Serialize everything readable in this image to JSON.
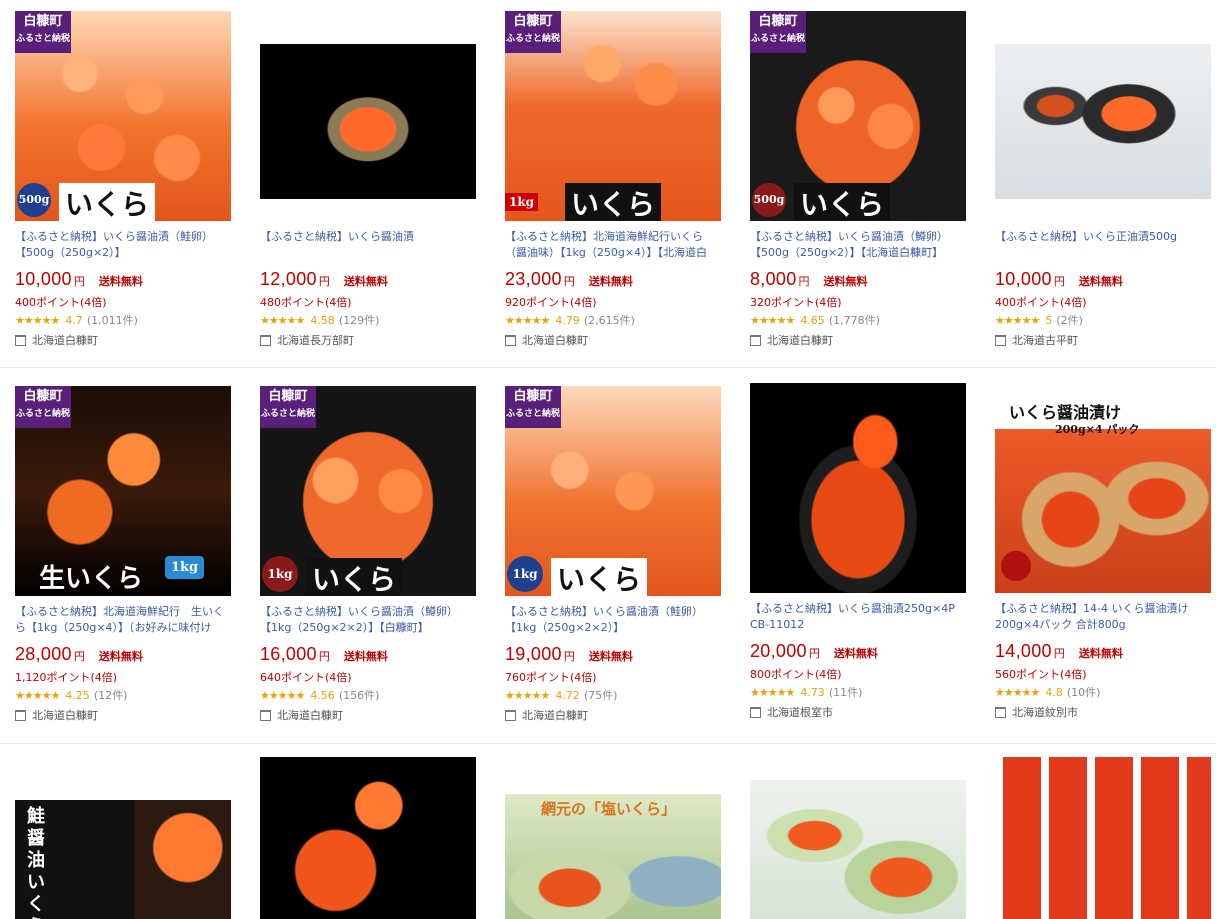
{
  "products": [
    {
      "title": "【ふるさと納税】いくら醤油漬（鮭卵）【500g（250g×2）】",
      "price": "10,000",
      "yen": "円",
      "shipping": "送料無料",
      "points": "400ポイント(4倍)",
      "stars": "★★★★★",
      "score": "4.7",
      "count": "(1,011件)",
      "shop": "北海道白糠町",
      "img": "ikura-bowl",
      "badge": "白糠町",
      "badge2": "ふるさと納税",
      "overlay": "いくら",
      "weight": "500g"
    },
    {
      "title": "【ふるさと納税】いくら醤油漬",
      "price": "12,000",
      "yen": "円",
      "shipping": "送料無料",
      "points": "480ポイント(4倍)",
      "stars": "★★★★★",
      "score": "4.58",
      "count": "(129件)",
      "shop": "北海道長万部町",
      "img": "dark-cup",
      "badge": "",
      "badge2": "",
      "overlay": "",
      "weight": ""
    },
    {
      "title": "【ふるさと納税】北海道海鮮紀行いくら（醤油味）【1kg（250g×4）】【北海道白糠…",
      "price": "23,000",
      "yen": "円",
      "shipping": "送料無料",
      "points": "920ポイント(4倍)",
      "stars": "★★★★★",
      "score": "4.79",
      "count": "(2,615件)",
      "shop": "北海道白糠町",
      "img": "spoon",
      "badge": "白糠町",
      "badge2": "ふるさと納税",
      "overlay": "いくら",
      "weight": "1kg"
    },
    {
      "title": "【ふるさと納税】いくら醤油漬（鱒卵）【500g（250g×2）】【北海道白糠町】",
      "price": "8,000",
      "yen": "円",
      "shipping": "送料無料",
      "points": "320ポイント(4倍)",
      "stars": "★★★★★",
      "score": "4.65",
      "count": "(1,778件)",
      "shop": "北海道白糠町",
      "img": "dark-bowl",
      "badge": "白糠町",
      "badge2": "ふるさと納税",
      "overlay": "いくら",
      "weight": "500g"
    },
    {
      "title": "【ふるさと納税】いくら正油漬500g",
      "price": "10,000",
      "yen": "円",
      "shipping": "送料無料",
      "points": "400ポイント(4倍)",
      "stars": "★★★★★",
      "score": "5",
      "count": "(2件)",
      "shop": "北海道古平町",
      "img": "light-bowls",
      "badge": "",
      "badge2": "",
      "overlay": "",
      "weight": ""
    },
    {
      "title": "【ふるさと納税】北海道海鮮紀行　生いくら【1kg（250g×4）】〔お好みに味付けが…",
      "price": "28,000",
      "yen": "円",
      "shipping": "送料無料",
      "points": "1,120ポイント(4倍)",
      "stars": "★★★★★",
      "score": "4.25",
      "count": "(12件)",
      "shop": "北海道白糠町",
      "img": "black-box",
      "badge": "白糠町",
      "badge2": "ふるさと納税",
      "overlay": "生いくら",
      "weight": "1kg"
    },
    {
      "title": "【ふるさと納税】いくら醤油漬（鱒卵）【1kg（250g×2×2）】【白糠町】",
      "price": "16,000",
      "yen": "円",
      "shipping": "送料無料",
      "points": "640ポイント(4倍)",
      "stars": "★★★★★",
      "score": "4.56",
      "count": "(156件)",
      "shop": "北海道白糠町",
      "img": "dark-bowl",
      "badge": "白糠町",
      "badge2": "ふるさと納税",
      "overlay": "いくら",
      "weight": "1kg"
    },
    {
      "title": "【ふるさと納税】いくら醤油漬（鮭卵）【1kg（250g×2×2）】",
      "price": "19,000",
      "yen": "円",
      "shipping": "送料無料",
      "points": "760ポイント(4倍)",
      "stars": "★★★★★",
      "score": "4.72",
      "count": "(75件)",
      "shop": "北海道白糠町",
      "img": "ikura-bowl",
      "badge": "白糠町",
      "badge2": "ふるさと納税",
      "overlay": "いくら",
      "weight": "1kg"
    },
    {
      "title": "【ふるさと納税】いくら醤油漬250g×4P CB-11012",
      "price": "20,000",
      "yen": "円",
      "shipping": "送料無料",
      "points": "800ポイント(4倍)",
      "stars": "★★★★★",
      "score": "4.73",
      "count": "(11件)",
      "shop": "北海道根室市",
      "img": "dark-cup",
      "badge": "",
      "badge2": "",
      "overlay": "",
      "weight": ""
    },
    {
      "title": "【ふるさと納税】14-4 いくら醤油漬け200g×4パック 合計800g",
      "price": "14,000",
      "yen": "円",
      "shipping": "送料無料",
      "points": "560ポイント(4倍)",
      "stars": "★★★★★",
      "score": "4.8",
      "count": "(10件)",
      "shop": "北海道紋別市",
      "img": "wood-box",
      "badge": "",
      "badge2": "",
      "overlay": "いくら醤油漬け",
      "weight": "200g×4 パック"
    },
    {
      "title": "",
      "price": "",
      "yen": "",
      "shipping": "",
      "points": "",
      "stars": "",
      "score": "",
      "count": "",
      "shop": "",
      "img": "black-label",
      "badge": "",
      "badge2": "",
      "overlay": "鮭醤油いくら",
      "weight": ""
    },
    {
      "title": "",
      "price": "",
      "yen": "",
      "shipping": "",
      "points": "",
      "stars": "",
      "score": "",
      "count": "",
      "shop": "",
      "img": "spoon-dark",
      "badge": "",
      "badge2": "",
      "overlay": "",
      "weight": ""
    },
    {
      "title": "",
      "price": "",
      "yen": "",
      "shipping": "",
      "points": "",
      "stars": "",
      "score": "",
      "count": "",
      "shop": "",
      "img": "green-bowls",
      "badge": "",
      "badge2": "",
      "overlay": "網元の「塩いくら」",
      "weight": ""
    },
    {
      "title": "",
      "price": "",
      "yen": "",
      "shipping": "",
      "points": "",
      "stars": "",
      "score": "",
      "count": "",
      "shop": "",
      "img": "light-bowls2",
      "badge": "",
      "badge2": "",
      "overlay": "",
      "weight": ""
    },
    {
      "title": "",
      "price": "",
      "yen": "",
      "shipping": "",
      "points": "",
      "stars": "",
      "score": "",
      "count": "",
      "shop": "",
      "img": "trays",
      "badge": "",
      "badge2": "",
      "overlay": "",
      "weight": ""
    }
  ]
}
